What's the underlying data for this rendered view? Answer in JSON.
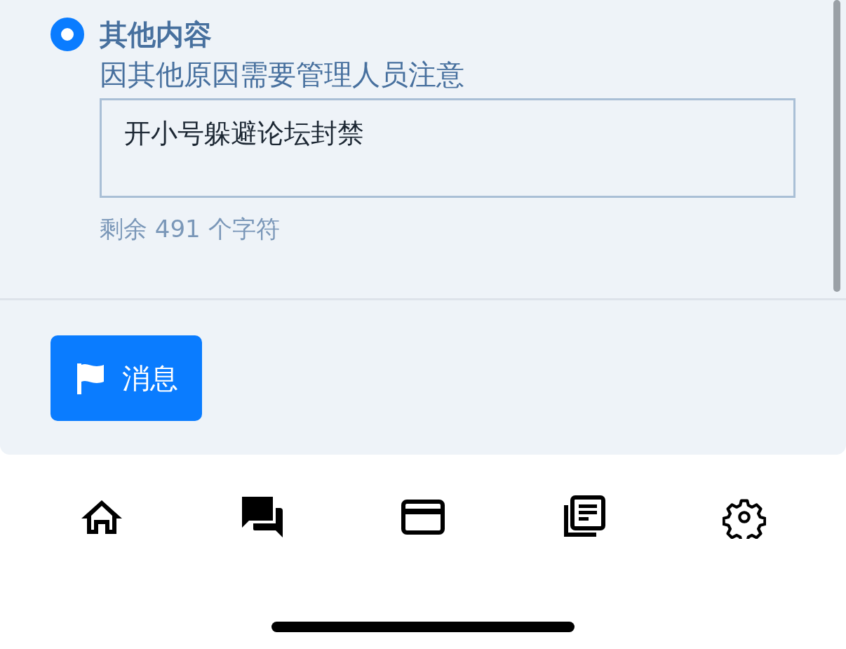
{
  "option": {
    "title": "其他内容",
    "description": "因其他原因需要管理人员注意",
    "selected": true
  },
  "message": {
    "value": "开小号躲避论坛封禁"
  },
  "counter": "剩余 491 个字符",
  "submit": {
    "label": "消息"
  },
  "tabbar": [
    {
      "kind": "home"
    },
    {
      "kind": "chat"
    },
    {
      "kind": "card"
    },
    {
      "kind": "news"
    },
    {
      "kind": "settings"
    }
  ]
}
